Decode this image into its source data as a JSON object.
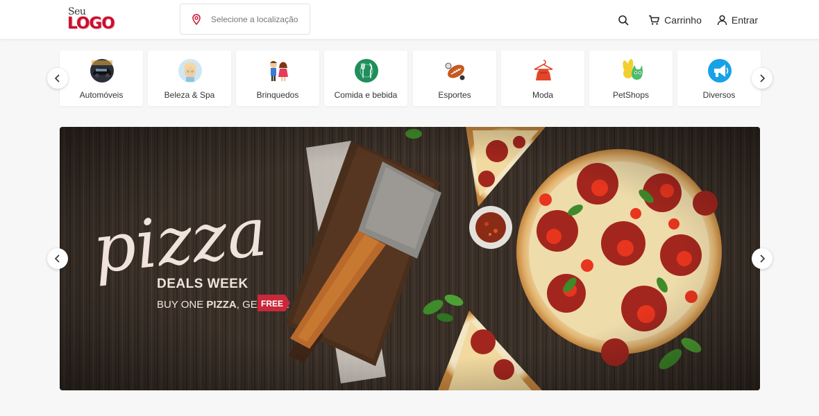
{
  "header": {
    "logo_small": "Seu",
    "logo_big": "LOGO",
    "location_placeholder": "Selecione a localização",
    "cart_label": "Carrinho",
    "login_label": "Entrar",
    "icons": {
      "location": "map-pin-icon",
      "search": "search-icon",
      "cart": "cart-icon",
      "user": "user-icon"
    }
  },
  "categories": [
    {
      "label": "Automóveis",
      "icon": "car-icon"
    },
    {
      "label": "Beleza & Spa",
      "icon": "spa-face-icon"
    },
    {
      "label": "Brinquedos",
      "icon": "kids-icon"
    },
    {
      "label": "Comida e bebida",
      "icon": "fork-knife-icon"
    },
    {
      "label": "Esportes",
      "icon": "football-icon"
    },
    {
      "label": "Moda",
      "icon": "dress-hanger-icon"
    },
    {
      "label": "PetShops",
      "icon": "pets-icon"
    },
    {
      "label": "Diversos",
      "icon": "megaphone-icon"
    }
  ],
  "banner": {
    "title": "pizza",
    "subtitle": "DEALS WEEK",
    "offer_part1": "BUY ONE ",
    "offer_part2": "PIZZA",
    "offer_part3": ", GET ONE",
    "badge": "FREE"
  },
  "colors": {
    "accent": "#c8102e",
    "badge": "#c8283a",
    "wood": "#3b3129"
  }
}
